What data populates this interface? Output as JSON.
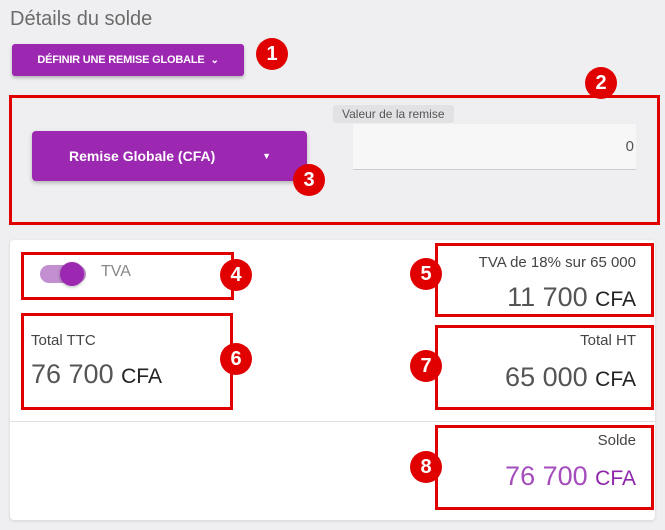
{
  "header": {
    "title": "Détails du solde"
  },
  "discount_button": {
    "label": "DÉFINIR UNE REMISE GLOBALE",
    "icon": "chevron-down-icon"
  },
  "discount": {
    "type_label": "Remise Globale (CFA)",
    "value_label": "Valeur de la remise",
    "value": "0"
  },
  "tva": {
    "label": "TVA",
    "enabled": true,
    "summary": "TVA de 18% sur 65 000",
    "amount": "11 700",
    "unit": "CFA"
  },
  "totals": {
    "ttc_label": "Total TTC",
    "ttc_value": "76 700",
    "ttc_unit": "CFA",
    "ht_label": "Total HT",
    "ht_value": "65 000",
    "ht_unit": "CFA",
    "solde_label": "Solde",
    "solde_value": "76 700",
    "solde_unit": "CFA"
  },
  "annotations": [
    "1",
    "2",
    "3",
    "4",
    "5",
    "6",
    "7",
    "8"
  ],
  "colors": {
    "accent": "#9c27b0",
    "highlight": "#e00000",
    "solde": "#a64dbd"
  }
}
